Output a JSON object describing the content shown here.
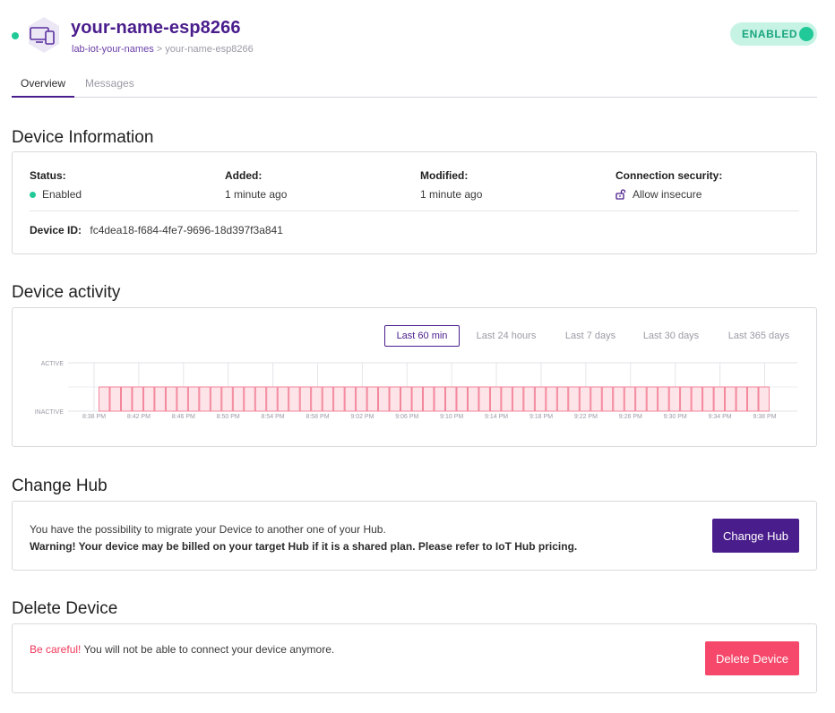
{
  "header": {
    "device_name": "your-name-esp8266",
    "breadcrumb_parent": "lab-iot-your-names",
    "breadcrumb_separator": ">",
    "breadcrumb_current": "your-name-esp8266",
    "status_toggle": "ENABLED",
    "device_icon": "devices-icon"
  },
  "tabs": [
    {
      "label": "Overview",
      "active": true
    },
    {
      "label": "Messages",
      "active": false
    }
  ],
  "device_info": {
    "title": "Device Information",
    "status_label": "Status:",
    "status_value": "Enabled",
    "added_label": "Added:",
    "added_value": "1 minute ago",
    "modified_label": "Modified:",
    "modified_value": "1 minute ago",
    "security_label": "Connection security:",
    "security_value": "Allow insecure",
    "security_icon": "unlock-icon",
    "device_id_label": "Device ID:",
    "device_id_value": "fc4dea18-f684-4fe7-9696-18d397f3a841"
  },
  "activity": {
    "title": "Device activity",
    "ranges": [
      {
        "label": "Last 60 min",
        "active": true
      },
      {
        "label": "Last 24 hours",
        "active": false
      },
      {
        "label": "Last 7 days",
        "active": false
      },
      {
        "label": "Last 30 days",
        "active": false
      },
      {
        "label": "Last 365 days",
        "active": false
      }
    ]
  },
  "chart_data": {
    "type": "bar",
    "y_levels": [
      "ACTIVE",
      "INACTIVE"
    ],
    "x_ticks": [
      "8:38 PM",
      "8:42 PM",
      "8:46 PM",
      "8:50 PM",
      "8:54 PM",
      "8:58 PM",
      "9:02 PM",
      "9:06 PM",
      "9:10 PM",
      "9:14 PM",
      "9:18 PM",
      "9:22 PM",
      "9:26 PM",
      "9:30 PM",
      "9:34 PM",
      "9:38 PM"
    ],
    "bar_count": 60,
    "bar_state": "INACTIVE",
    "bar_fill": "#fde4e8",
    "bar_stroke": "#f27b92",
    "grid": true
  },
  "change_hub": {
    "title": "Change Hub",
    "description": "You have the possibility to migrate your Device to another one of your Hub.",
    "warning": "Warning! Your device may be billed on your target Hub if it is a shared plan. Please refer to IoT Hub pricing.",
    "button": "Change Hub"
  },
  "delete_device": {
    "title": "Delete Device",
    "careful": "Be careful!",
    "message": " You will not be able to connect your device anymore.",
    "button": "Delete Device"
  },
  "colors": {
    "brand": "#4a1d8c",
    "success": "#20c997",
    "danger": "#f5486a"
  }
}
